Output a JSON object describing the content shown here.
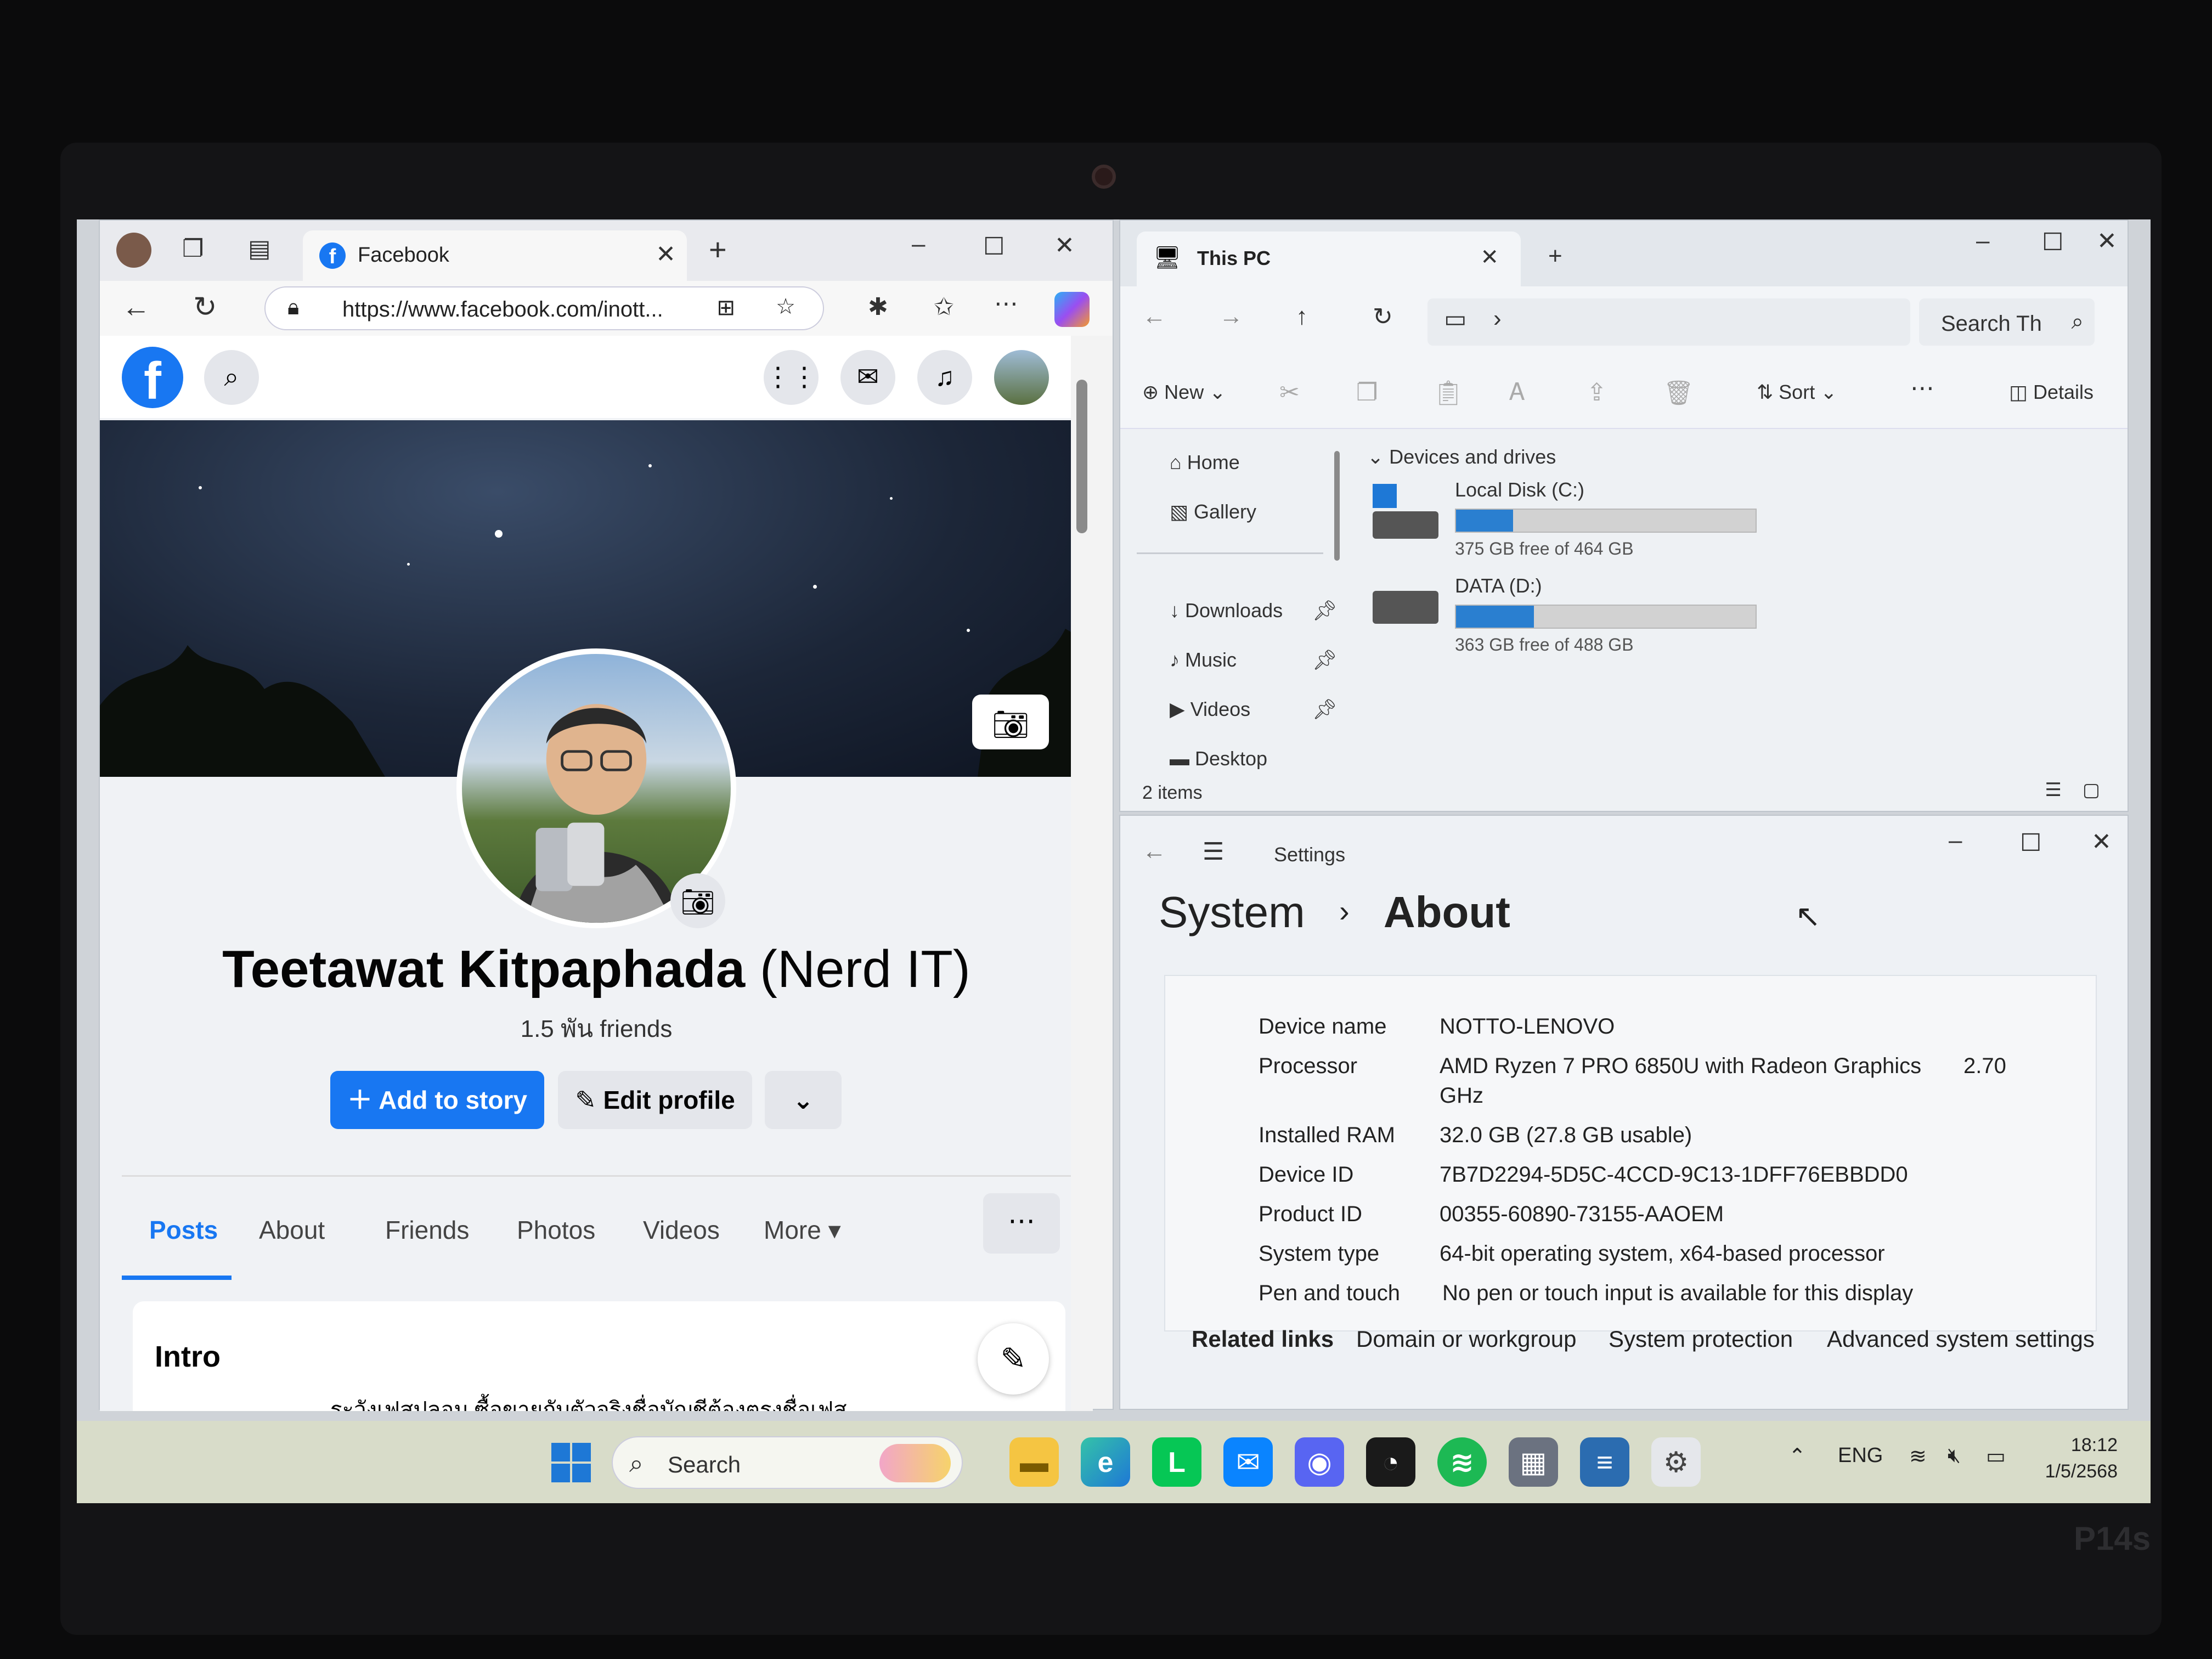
{
  "edge": {
    "tab_title": "Facebook",
    "url": "https://www.facebook.com/inott...",
    "new_tab": "+"
  },
  "facebook": {
    "logo": "f",
    "profile_name": "Teetawat Kitpaphada",
    "nickname": "(Nerd IT)",
    "friends": "1.5 พัน friends",
    "add_story": "Add to story",
    "edit_profile": "Edit profile",
    "tabs": [
      "Posts",
      "About",
      "Friends",
      "Photos",
      "Videos",
      "More"
    ],
    "intro_title": "Intro",
    "intro_text": "ระวังเฟสปลอม ซื้อขายกับตัวจริงชื่อบัญชีต้องตรงชื่อเฟส"
  },
  "explorer": {
    "tab_title": "This PC",
    "search_placeholder": "Search Th",
    "cmd": {
      "new": "New",
      "sort": "Sort",
      "details": "Details"
    },
    "sidebar": [
      "Home",
      "Gallery",
      "Downloads",
      "Music",
      "Videos",
      "Desktop"
    ],
    "section": "Devices and drives",
    "drives": [
      {
        "name": "Local Disk (C:)",
        "free": "375 GB free of 464 GB",
        "used_fraction": 0.19
      },
      {
        "name": "DATA (D:)",
        "free": "363 GB free of 488 GB",
        "used_fraction": 0.26
      }
    ],
    "status": "2 items"
  },
  "settings": {
    "title": "Settings",
    "crumb_parent": "System",
    "crumb_sep": "›",
    "crumb_current": "About",
    "rows": [
      {
        "k": "Device name",
        "v": "NOTTO-LENOVO"
      },
      {
        "k": "Processor",
        "v": "AMD Ryzen 7 PRO 6850U with Radeon Graphics",
        "v2": "2.70",
        "v3": "GHz"
      },
      {
        "k": "Installed RAM",
        "v": "32.0 GB (27.8 GB usable)"
      },
      {
        "k": "Device ID",
        "v": "7B7D2294-5D5C-4CCD-9C13-1DFF76EBBDD0"
      },
      {
        "k": "Product ID",
        "v": "00355-60890-73155-AAOEM"
      },
      {
        "k": "System type",
        "v": "64-bit operating system, x64-based processor"
      },
      {
        "k": "Pen and touch",
        "v": "No pen or touch input is available for this display"
      }
    ],
    "related_title": "Related links",
    "related": [
      "Domain or workgroup",
      "System protection",
      "Advanced system settings"
    ]
  },
  "taskbar": {
    "search": "Search",
    "lang": "ENG",
    "time": "18:12",
    "date": "1/5/2568"
  },
  "bezel_brand": "P14s",
  "colors": {
    "fb_blue": "#1877f2",
    "drive_fill": "#2a7fd0",
    "taskbar": "#d8dcc9"
  }
}
